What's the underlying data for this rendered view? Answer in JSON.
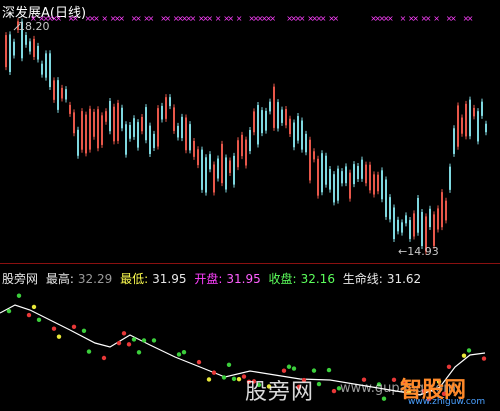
{
  "title": "深发展A(日线)",
  "high_label": "18.20",
  "low_label": "←14.93",
  "info": {
    "name": "股旁网",
    "high_label": "最高:",
    "high_value": "32.29",
    "low_label": "最低:",
    "low_value": "31.95",
    "open_label": "开盘:",
    "open_value": "31.95",
    "close_label": "收盘:",
    "close_value": "32.16",
    "life_label": "生命线:",
    "life_value": "31.62"
  },
  "watermark": {
    "text": "股旁网",
    "url": "www.gupang.com",
    "logo": "智股网",
    "logo_url": "www.zhiguw.com"
  },
  "colors": {
    "up": "#e8574a",
    "down": "#7fd8e0",
    "x_mark": "#ff40ff",
    "life_line": "#ffffff",
    "dot_green": "#3ccf3c",
    "dot_red": "#e83838",
    "dot_yellow": "#e8e83a"
  }
}
